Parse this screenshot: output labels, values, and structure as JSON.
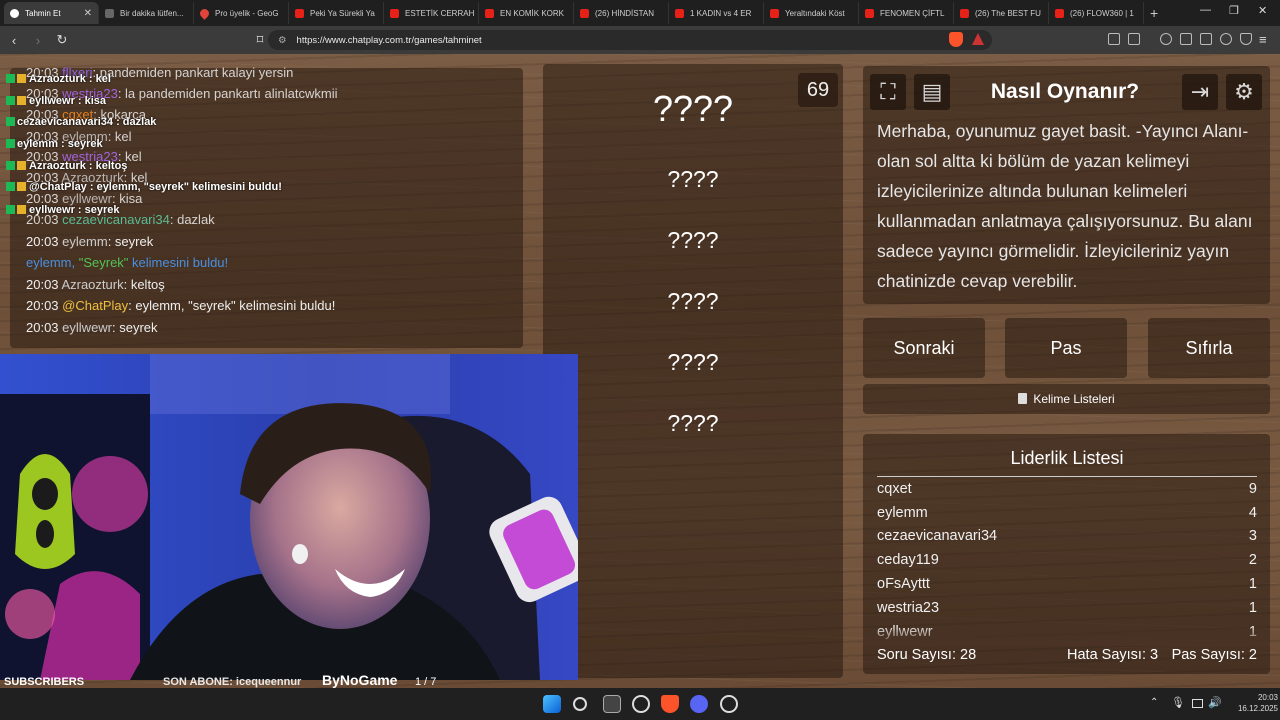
{
  "browser": {
    "tabs": [
      {
        "label": "Tahmin Et",
        "icon": "chatplay-icon",
        "active": true
      },
      {
        "label": "Bir dakika lütfen...",
        "icon": "page-icon"
      },
      {
        "label": "Pro üyelik - GeoG",
        "icon": "map-pin-icon"
      },
      {
        "label": "Peki Ya Sürekli Ya",
        "icon": "youtube-icon"
      },
      {
        "label": "ESTETİK CERRAH",
        "icon": "youtube-icon"
      },
      {
        "label": "EN KOMİK KORK",
        "icon": "youtube-icon"
      },
      {
        "label": "(26) HİNDİSTAN",
        "icon": "youtube-icon"
      },
      {
        "label": "1 KADIN vs 4 ER",
        "icon": "youtube-icon"
      },
      {
        "label": "Yeraltındaki Köst",
        "icon": "youtube-icon"
      },
      {
        "label": "FENOMEN ÇİFTL",
        "icon": "youtube-icon"
      },
      {
        "label": "(26) The BEST FU",
        "icon": "youtube-icon"
      },
      {
        "label": "(26) FLOW360 | 1",
        "icon": "youtube-icon"
      }
    ],
    "url": "https://www.chatplay.com.tr/games/tahminet"
  },
  "chat": {
    "messages": [
      {
        "time": "20:03",
        "user": "fllxeri",
        "user_color": "#9b6cff",
        "text": "pandemiden pankart kalayi yersin"
      },
      {
        "time": "20:03",
        "user": "westria23",
        "user_color": "#b36cff",
        "text": "la pandemiden pankartı alinlatcwkmii"
      },
      {
        "time": "20:03",
        "user": "cqxet",
        "user_color": "#ff8c1a",
        "text": "kokarca"
      },
      {
        "time": "20:03",
        "user": "eylemm",
        "user_color": "#cccccc",
        "text": "kel"
      },
      {
        "time": "20:03",
        "user": "westria23",
        "user_color": "#b36cff",
        "text": "kel"
      },
      {
        "time": "20:03",
        "user": "Azraozturk",
        "user_color": "#cccccc",
        "text": "kel"
      },
      {
        "time": "20:03",
        "user": "eyllwewr",
        "user_color": "#cccccc",
        "text": "kisa"
      },
      {
        "time": "20:03",
        "user": "cezaevicanavari34",
        "user_color": "#5fd3a8",
        "text": "dazlak"
      },
      {
        "time": "20:03",
        "user": "eylemm",
        "user_color": "#cccccc",
        "text": "seyrek"
      },
      {
        "time": "",
        "user": "eylemm, ",
        "user_color": "#4a8fe0",
        "highlight": "\"Seyrek\"",
        "text": " kelimesini buldu!"
      },
      {
        "time": "20:03",
        "user": "Azraozturk",
        "user_color": "#cccccc",
        "text": "keltoş"
      },
      {
        "time": "20:03",
        "user": "@ChatPlay",
        "user_color": "#f0c040",
        "text": "eylemm, \"seyrek\" kelimesini buldu!"
      },
      {
        "time": "20:03",
        "user": "eyllwewr",
        "user_color": "#cccccc",
        "text": "seyrek"
      }
    ],
    "overlay": [
      {
        "text": "Azraozturk : kel"
      },
      {
        "text": "eyllwewr : kisa"
      },
      {
        "text": "cezaevicanavari34 : dazlak"
      },
      {
        "text": "eylemm : seyrek"
      },
      {
        "text": "Azraozturk : keltoş"
      },
      {
        "text": "@ChatPlay : eylemm, \"seyrek\" kelimesini buldu!"
      },
      {
        "text": "eyllwewr : seyrek"
      }
    ]
  },
  "game": {
    "counter": "69",
    "words": [
      "????",
      "????",
      "????",
      "????",
      "????",
      "????"
    ]
  },
  "howto": {
    "title": "Nasıl Oynanır?",
    "text": "Merhaba, oyunumuz gayet basit. -Yayıncı Alanı- olan sol altta ki bölüm de yazan kelimeyi izleyicilerinize altında bulunan kelimeleri kullanmadan anlatmaya çalışıyorsunuz. Bu alanı sadece yayıncı görmelidir. İzleyicileriniz yayın chatinizde cevap verebilir."
  },
  "actions": {
    "next": "Sonraki",
    "pass": "Pas",
    "reset": "Sıfırla",
    "word_lists": "Kelime Listeleri"
  },
  "leaderboard": {
    "title": "Liderlik Listesi",
    "rows": [
      {
        "name": "cqxet",
        "score": "9"
      },
      {
        "name": "eylemm",
        "score": "4"
      },
      {
        "name": "cezaevicanavari34",
        "score": "3"
      },
      {
        "name": "ceday119",
        "score": "2"
      },
      {
        "name": "oFsAyttt",
        "score": "1"
      },
      {
        "name": "westria23",
        "score": "1"
      },
      {
        "name": "eyllwewr",
        "score": "1"
      }
    ]
  },
  "stats": {
    "questions": "Soru Sayısı: 28",
    "errors": "Hata Sayısı: 3",
    "passes": "Pas Sayısı: 2"
  },
  "stream": {
    "subscribers_label": "SUBSCRIBERS",
    "last_sub": "SON ABONE: icequeennur",
    "brand": "ByNoGame",
    "page": "1 / 7",
    "sub_progress": 0.14
  },
  "taskbar": {
    "time": "20:03",
    "date": "16.12.2025"
  }
}
